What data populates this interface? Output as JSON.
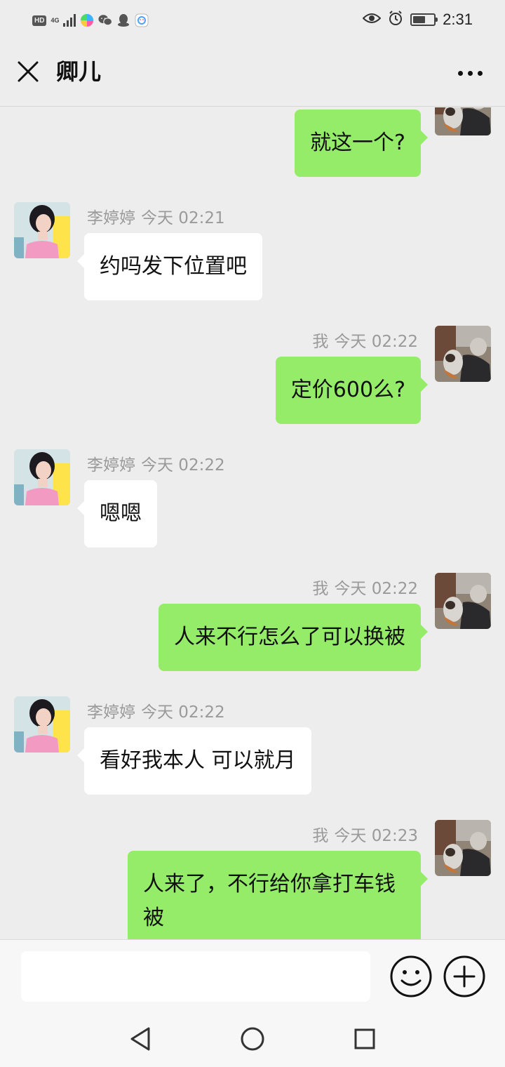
{
  "status_bar": {
    "hd_label": "HD",
    "network_label": "4G",
    "time": "2:31",
    "battery_level": 0.6
  },
  "header": {
    "title": "卿儿"
  },
  "messages": [
    {
      "side": "right",
      "sender": "",
      "time": "",
      "text": "就这一个?"
    },
    {
      "side": "left",
      "sender": "李婷婷",
      "time": "今天 02:21",
      "text": "约吗发下位置吧"
    },
    {
      "side": "right",
      "sender": "我",
      "time": "今天 02:22",
      "text": "定价600么?"
    },
    {
      "side": "left",
      "sender": "李婷婷",
      "time": "今天 02:22",
      "text": "嗯嗯"
    },
    {
      "side": "right",
      "sender": "我",
      "time": "今天 02:22",
      "text": "人来不行怎么了可以换被"
    },
    {
      "side": "left",
      "sender": "李婷婷",
      "time": "今天 02:22",
      "text": "看好我本人 可以就月"
    },
    {
      "side": "right",
      "sender": "我",
      "time": "今天 02:23",
      "text": "人来了，不行给你拿打车钱被"
    }
  ],
  "input": {
    "placeholder": ""
  },
  "colors": {
    "background": "#ededed",
    "sent_bubble": "#95ec69",
    "received_bubble": "#ffffff",
    "meta_text": "#9a9a9a"
  },
  "icons": {
    "close": "close-icon",
    "more": "more-icon",
    "emoji": "emoji-icon",
    "plus": "plus-icon",
    "back": "back-icon",
    "home": "home-icon",
    "recents": "recents-icon"
  }
}
